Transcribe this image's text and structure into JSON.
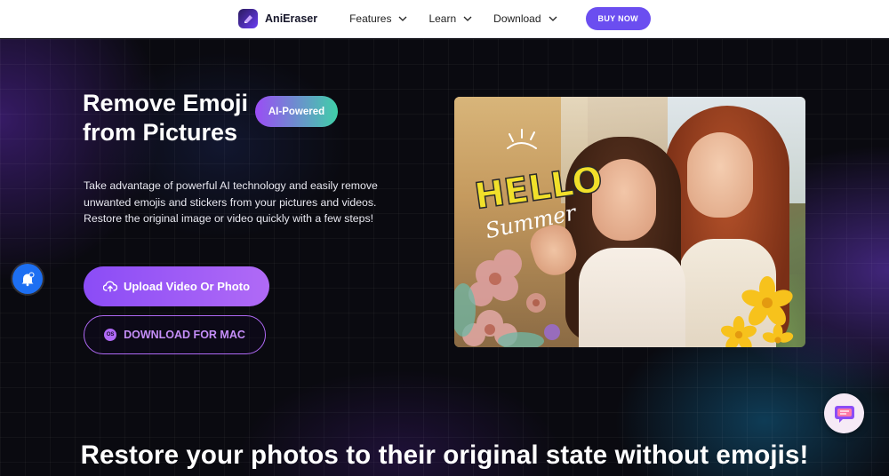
{
  "nav": {
    "brand": "AniEraser",
    "items": [
      {
        "label": "Features"
      },
      {
        "label": "Learn"
      },
      {
        "label": "Download"
      }
    ],
    "buy_label": "BUY NOW"
  },
  "hero": {
    "title": "Remove Emoji from Pictures",
    "badge": "AI-Powered",
    "description": "Take advantage of powerful AI technology and easily remove unwanted emojis and stickers from your pictures and videos. Restore the original image or video quickly with a few steps!",
    "upload_label": "Upload Video Or Photo",
    "mac_label": "DOWNLOAD FOR MAC",
    "mac_icon_text": "OS"
  },
  "photo": {
    "sticker_line1": "HELLO",
    "sticker_line2": "Summer"
  },
  "section": {
    "title": "Restore your photos to their original state without emojis!"
  },
  "colors": {
    "accent": "#6b4ef0",
    "button_gradient_start": "#8b4cf6",
    "button_gradient_end": "#b06af6",
    "badge_gradient_start": "#9b4cf5",
    "badge_gradient_end": "#3fd0a8",
    "notification_blue": "#1d6ff2"
  }
}
